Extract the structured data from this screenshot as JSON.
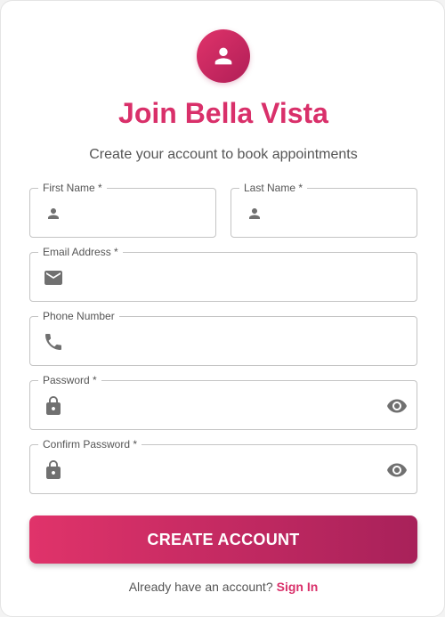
{
  "header": {
    "title": "Join Bella Vista",
    "subtitle": "Create your account to book appointments"
  },
  "fields": {
    "first_name": {
      "label": "First Name *",
      "icon": "person-icon",
      "value": ""
    },
    "last_name": {
      "label": "Last Name *",
      "icon": "person-icon",
      "value": ""
    },
    "email": {
      "label": "Email Address *",
      "icon": "mail-icon",
      "value": ""
    },
    "phone": {
      "label": "Phone Number",
      "icon": "phone-icon",
      "value": ""
    },
    "password": {
      "label": "Password *",
      "icon": "lock-icon",
      "value": "",
      "toggle_icon": "eye-icon"
    },
    "confirm_password": {
      "label": "Confirm Password *",
      "icon": "lock-icon",
      "value": "",
      "toggle_icon": "eye-icon"
    }
  },
  "submit": {
    "label": "CREATE ACCOUNT"
  },
  "footer": {
    "prompt": "Already have an account?",
    "link_label": "Sign In"
  },
  "colors": {
    "accent": "#d9306a",
    "accent_dark": "#a8215a",
    "icon": "#707070"
  }
}
